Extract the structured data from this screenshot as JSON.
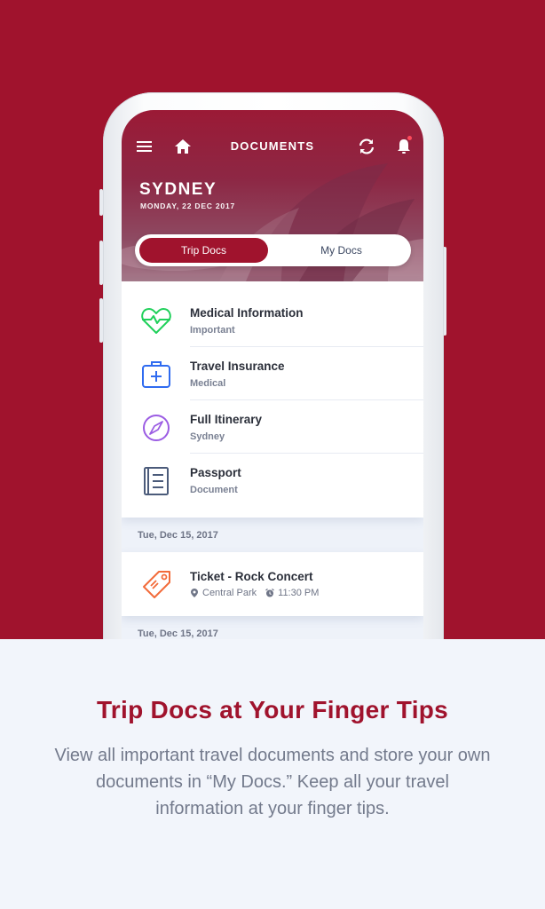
{
  "app": {
    "header_title": "DOCUMENTS",
    "city": "SYDNEY",
    "date": "MONDAY, 22 DEC 2017",
    "icons": {
      "menu": "menu-icon",
      "home": "home-icon",
      "refresh": "refresh-icon",
      "notifications": "bell-icon"
    },
    "tabs": [
      {
        "label": "Trip Docs",
        "active": true
      },
      {
        "label": "My Docs",
        "active": false
      }
    ],
    "documents": [
      {
        "title": "Medical Information",
        "subtitle": "Important",
        "icon": "heart-pulse-icon",
        "color": "#1fd05a"
      },
      {
        "title": "Travel Insurance",
        "subtitle": "Medical",
        "icon": "medical-kit-icon",
        "color": "#2f6bf0"
      },
      {
        "title": "Full Itinerary",
        "subtitle": "Sydney",
        "icon": "compass-icon",
        "color": "#9b5ce3"
      },
      {
        "title": "Passport",
        "subtitle": "Document",
        "icon": "book-icon",
        "color": "#4b5b7a"
      }
    ],
    "events": [
      {
        "date": "Tue, Dec 15, 2017",
        "title": "Ticket - Rock Concert",
        "location": "Central Park",
        "time": "11:30 PM",
        "icon": "ticket-tag-icon",
        "color": "#f26b3a"
      },
      {
        "date": "Tue, Dec 15, 2017"
      }
    ]
  },
  "promo": {
    "headline": "Trip Docs at Your Finger Tips",
    "description": "View all important travel documents and store your own documents in “My Docs.” Keep all your travel information at your finger tips."
  },
  "colors": {
    "brand": "#a0132d",
    "background_bottom": "#f2f5fb"
  }
}
